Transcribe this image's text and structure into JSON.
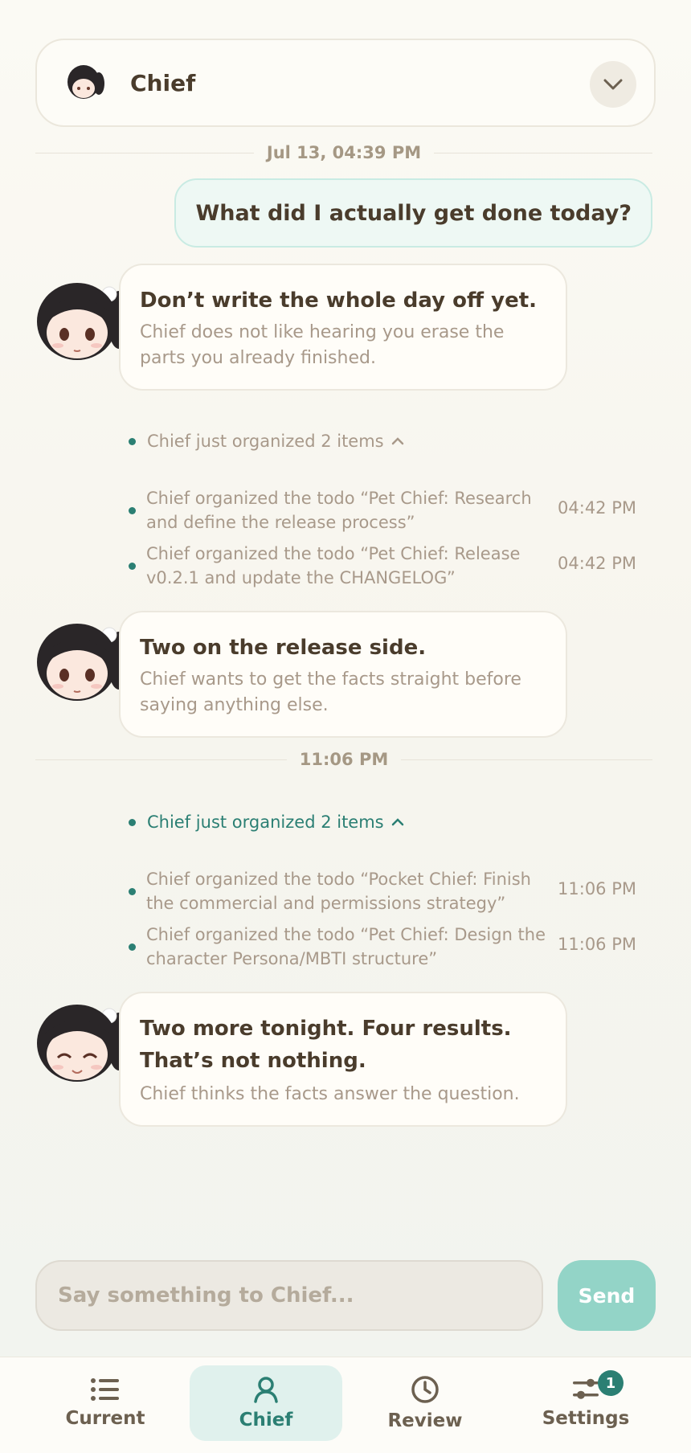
{
  "header": {
    "title": "Chief"
  },
  "timestamps": [
    "Jul 13, 04:39 PM",
    "11:06 PM"
  ],
  "user_message": "What did I actually get done today?",
  "messages": [
    {
      "title": "Don’t write the whole day off yet.",
      "subtitle": "Chief does not like hearing you erase the parts you already finished."
    },
    {
      "title": "Two on the release side.",
      "subtitle": "Chief wants to get the facts straight before saying anything else."
    },
    {
      "title": "Two more tonight. Four results. That’s not nothing.",
      "subtitle": "Chief thinks the facts answer the question."
    }
  ],
  "tool_groups": [
    {
      "summary": "Chief just organized 2 items",
      "items": [
        {
          "text": "Chief organized the todo “Pet Chief: Research and define the release process”",
          "time": "04:42 PM"
        },
        {
          "text": "Chief organized the todo “Pet Chief: Release v0.2.1 and update the CHANGELOG”",
          "time": "04:42 PM"
        }
      ]
    },
    {
      "summary": "Chief just organized 2 items",
      "items": [
        {
          "text": "Chief organized the todo “Pocket Chief: Finish the commercial and permissions strategy”",
          "time": "11:06 PM"
        },
        {
          "text": "Chief organized the todo “Pet Chief: Design the character Persona/MBTI structure”",
          "time": "11:06 PM"
        }
      ]
    }
  ],
  "composer": {
    "placeholder": "Say something to Chief...",
    "send_label": "Send"
  },
  "tabs": [
    {
      "label": "Current",
      "icon": "list-icon"
    },
    {
      "label": "Chief",
      "icon": "person-icon",
      "active": true
    },
    {
      "label": "Review",
      "icon": "clock-icon"
    },
    {
      "label": "Settings",
      "icon": "sliders-icon",
      "badge": "1"
    }
  ],
  "colors": {
    "accent": "#2b7f73",
    "send": "#93d4c7",
    "user_bubble": "#eef8f4"
  }
}
